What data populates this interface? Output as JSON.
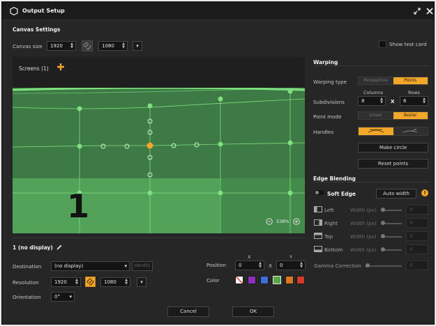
{
  "window": {
    "title": "Output Setup"
  },
  "canvas": {
    "section_title": "Canvas Settings",
    "size_label": "Canvas size",
    "width": "1920",
    "height": "1080",
    "show_test_card_label": "Show test card"
  },
  "screens": {
    "header": "Screens (1)",
    "zoom": "538%",
    "screen_number": "1"
  },
  "warping": {
    "title": "Warping",
    "type_label": "Warping type",
    "type_options": [
      "Perspective",
      "Points"
    ],
    "subdivisions_label": "Subdivisions",
    "columns_label": "Columns",
    "rows_label": "Rows",
    "columns": "8",
    "rows": "6",
    "x_sep": "X",
    "point_mode_label": "Point mode",
    "point_mode_options": [
      "Linear",
      "Bezier"
    ],
    "handles_label": "Handles",
    "make_circle": "Make circle",
    "reset_points": "Reset points"
  },
  "edge_blending": {
    "title": "Edge Blending",
    "soft_edge_label": "Soft Edge",
    "auto_width": "Auto width",
    "info": "!",
    "width_label": "Width (px)",
    "sides": [
      {
        "label": "Left",
        "value": "0"
      },
      {
        "label": "Right",
        "value": "0"
      },
      {
        "label": "Top",
        "value": "0"
      },
      {
        "label": "Bottom",
        "value": "0"
      }
    ],
    "gamma_label": "Gamma Correction",
    "gamma_value": "0"
  },
  "display": {
    "title": "1 (no display)",
    "destination_label": "Destination",
    "destination_value": "(no display)",
    "identify": "Identify",
    "resolution_label": "Resolution",
    "res_width": "1920",
    "res_height": "1080",
    "orientation_label": "Orientation",
    "orientation_value": "0°",
    "position_label": "Position",
    "pos_x_label": "X",
    "pos_y_label": "Y",
    "pos_x": "0",
    "pos_y": "0",
    "pos_sep": "X",
    "color_label": "Color",
    "colors": [
      "#3e53c5",
      "#8c2fbd",
      "#3d6bd8",
      "#5aa845",
      "#e0761f",
      "#d63a2c"
    ]
  },
  "footer": {
    "cancel": "Cancel",
    "ok": "OK"
  }
}
